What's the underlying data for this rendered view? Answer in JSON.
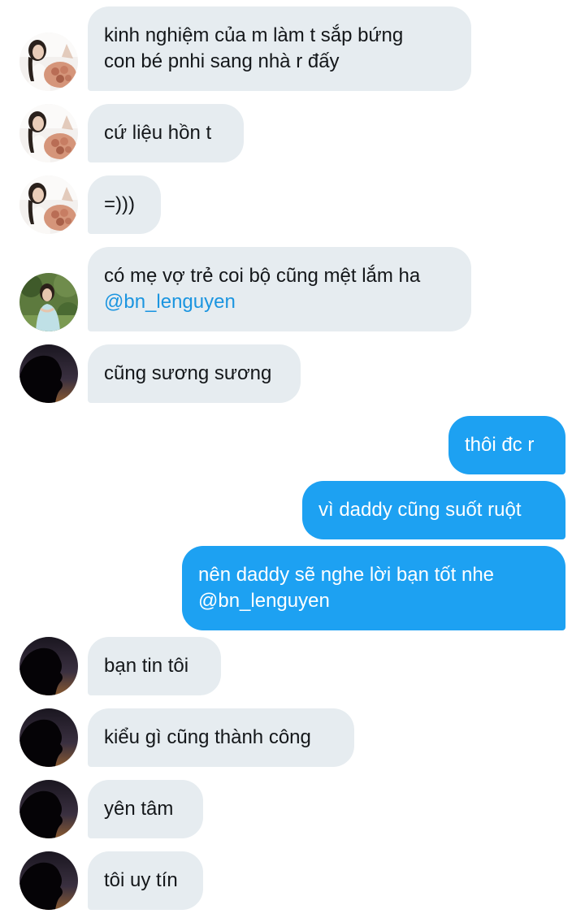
{
  "messages": [
    {
      "side": "in",
      "avatar": "girl-bouquet",
      "lines": [
        "kinh nghiệm của m làm t sắp bứng",
        "con bé pnhi sang nhà r đấy"
      ]
    },
    {
      "side": "in",
      "avatar": "girl-bouquet",
      "lines": [
        "cứ liệu hồn t"
      ]
    },
    {
      "side": "in",
      "avatar": "girl-bouquet",
      "lines": [
        "=)))"
      ]
    },
    {
      "side": "in",
      "avatar": "girl-garden",
      "lines": [
        "có mẹ vợ trẻ coi bộ cũng mệt lắm ha"
      ],
      "mention": "@bn_lenguyen"
    },
    {
      "side": "in",
      "avatar": "silhouette",
      "lines": [
        "cũng sương sương"
      ]
    },
    {
      "side": "out",
      "lines": [
        "thôi đc r"
      ]
    },
    {
      "side": "out",
      "lines": [
        "vì daddy cũng suốt ruột"
      ]
    },
    {
      "side": "out",
      "lines": [
        "nên daddy sẽ nghe lời bạn tốt nhe"
      ],
      "mention": "@bn_lenguyen"
    },
    {
      "side": "in",
      "avatar": "silhouette",
      "lines": [
        "bạn tin tôi"
      ]
    },
    {
      "side": "in",
      "avatar": "silhouette",
      "lines": [
        "kiểu gì cũng thành công"
      ]
    },
    {
      "side": "in",
      "avatar": "silhouette",
      "lines": [
        "yên tâm"
      ]
    },
    {
      "side": "in",
      "avatar": "silhouette",
      "lines": [
        "tôi uy tín"
      ]
    }
  ],
  "colors": {
    "incoming_bubble": "#e6ecf0",
    "outgoing_bubble": "#1da1f2",
    "mention": "#1b95e0",
    "text": "#14171a"
  }
}
